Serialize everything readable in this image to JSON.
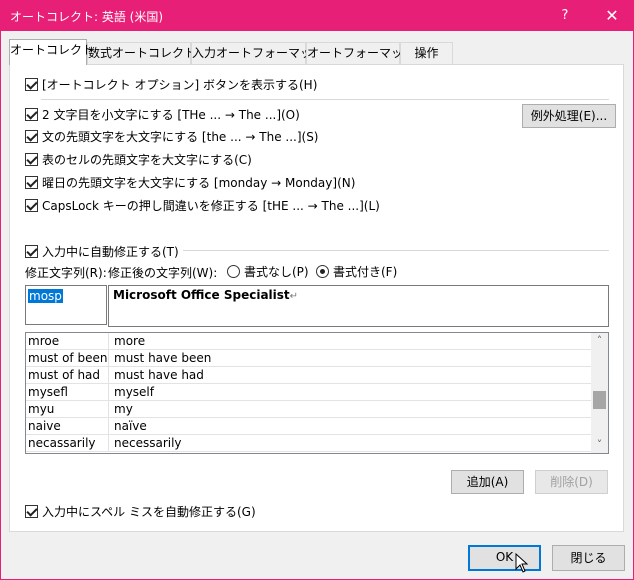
{
  "window": {
    "title": "オートコレクト: 英語 (米国)",
    "help_label": "?",
    "close_label": "✕",
    "accent_color": "#e81f77"
  },
  "tabs": [
    {
      "label": "オートコレクト",
      "active": true
    },
    {
      "label": "数式オートコレクト",
      "active": false
    },
    {
      "label": "入力オートフォーマット",
      "active": false
    },
    {
      "label": "オートフォーマット",
      "active": false
    },
    {
      "label": "操作",
      "active": false
    }
  ],
  "options": {
    "show_buttons": {
      "label": "[オートコレクト オプション] ボタンを表示する(H)",
      "checked": true
    },
    "two_initial_caps": {
      "label": "2 文字目を小文字にする [THe ... → The ...](O)",
      "checked": true
    },
    "capitalize_sentence": {
      "label": "文の先頭文字を大文字にする [the ... → The ...](S)",
      "checked": true
    },
    "capitalize_table_cell": {
      "label": "表のセルの先頭文字を大文字にする(C)",
      "checked": true
    },
    "capitalize_days": {
      "label": "曜日の先頭文字を大文字にする [monday →  Monday](N)",
      "checked": true
    },
    "caps_lock": {
      "label": "CapsLock キーの押し間違いを修正する [tHE ... → The ...](L)",
      "checked": true
    },
    "exceptions_button": "例外処理(E)...",
    "replace_as_you_type": {
      "label": "入力中に自動修正する(T)",
      "checked": true
    }
  },
  "replace": {
    "replace_label": "修正文字列(R):",
    "with_label": "修正後の文字列(W):",
    "plain_text_label": "書式なし(P)",
    "formatted_text_label": "書式付き(F)",
    "formatted_selected": true,
    "replace_value": "mosp",
    "with_value": "Microsoft Office Specialist",
    "paragraph_mark": "↵"
  },
  "entries": [
    {
      "replace": "mroe",
      "with": "more"
    },
    {
      "replace": "must of been",
      "with": "must have been"
    },
    {
      "replace": "must of had",
      "with": "must have had"
    },
    {
      "replace": "mysefl",
      "with": "myself"
    },
    {
      "replace": "myu",
      "with": "my"
    },
    {
      "replace": "naive",
      "with": "naïve"
    },
    {
      "replace": "necassarily",
      "with": "necessarily"
    }
  ],
  "list_scroll": {
    "up_arrow": "˄",
    "down_arrow": "˅",
    "position_fraction": 0.5
  },
  "buttons": {
    "add": "追加(A)",
    "delete": "削除(D)",
    "spell_checker": {
      "label": "入力中にスペル ミスを自動修正する(G)",
      "checked": true
    },
    "ok": "OK",
    "close": "閉じる"
  }
}
